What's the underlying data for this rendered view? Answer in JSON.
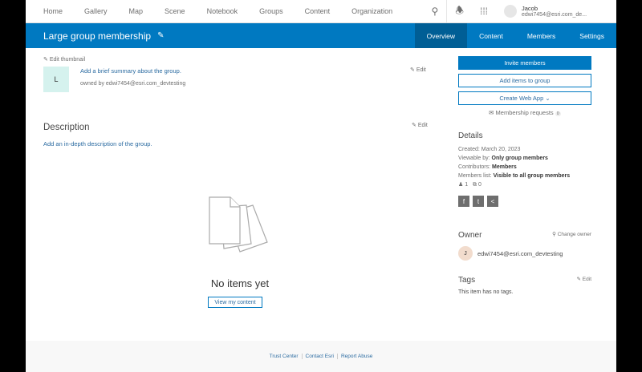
{
  "nav": {
    "items": [
      "Home",
      "Gallery",
      "Map",
      "Scene",
      "Notebook",
      "Groups",
      "Content",
      "Organization"
    ],
    "user_name": "Jacob",
    "user_email": "edwi7454@esri.com_de..."
  },
  "banner": {
    "title": "Large group membership",
    "tabs": [
      "Overview",
      "Content",
      "Members",
      "Settings"
    ],
    "active_tab": "Overview"
  },
  "summary": {
    "edit_thumbnail": "Edit thumbnail",
    "thumb_letter": "L",
    "summary_link": "Add a brief summary about the group.",
    "owned_by": "owned by edwi7454@esri.com_devtesting",
    "edit": "Edit"
  },
  "description": {
    "heading": "Description",
    "link": "Add an in-depth description of the group.",
    "edit": "Edit"
  },
  "empty": {
    "title": "No items yet",
    "button": "View my content"
  },
  "actions": {
    "invite": "Invite members",
    "add_items": "Add items to group",
    "create_app": "Create Web App",
    "requests": "Membership requests",
    "requests_count": "0"
  },
  "details": {
    "heading": "Details",
    "created": "Created: March 20, 2023",
    "viewable_label": "Viewable by:",
    "viewable_value": "Only group members",
    "contrib_label": "Contributors:",
    "contrib_value": "Members",
    "members_label": "Members list:",
    "members_value": "Visible to all group members",
    "members_count": "1",
    "content_count": "0"
  },
  "owner": {
    "heading": "Owner",
    "change": "Change owner",
    "initial": "J",
    "email": "edwi7454@esri.com_devtesting"
  },
  "tags": {
    "heading": "Tags",
    "edit": "Edit",
    "empty": "This item has no tags."
  },
  "footer": [
    "Trust Center",
    "Contact Esri",
    "Report Abuse"
  ]
}
